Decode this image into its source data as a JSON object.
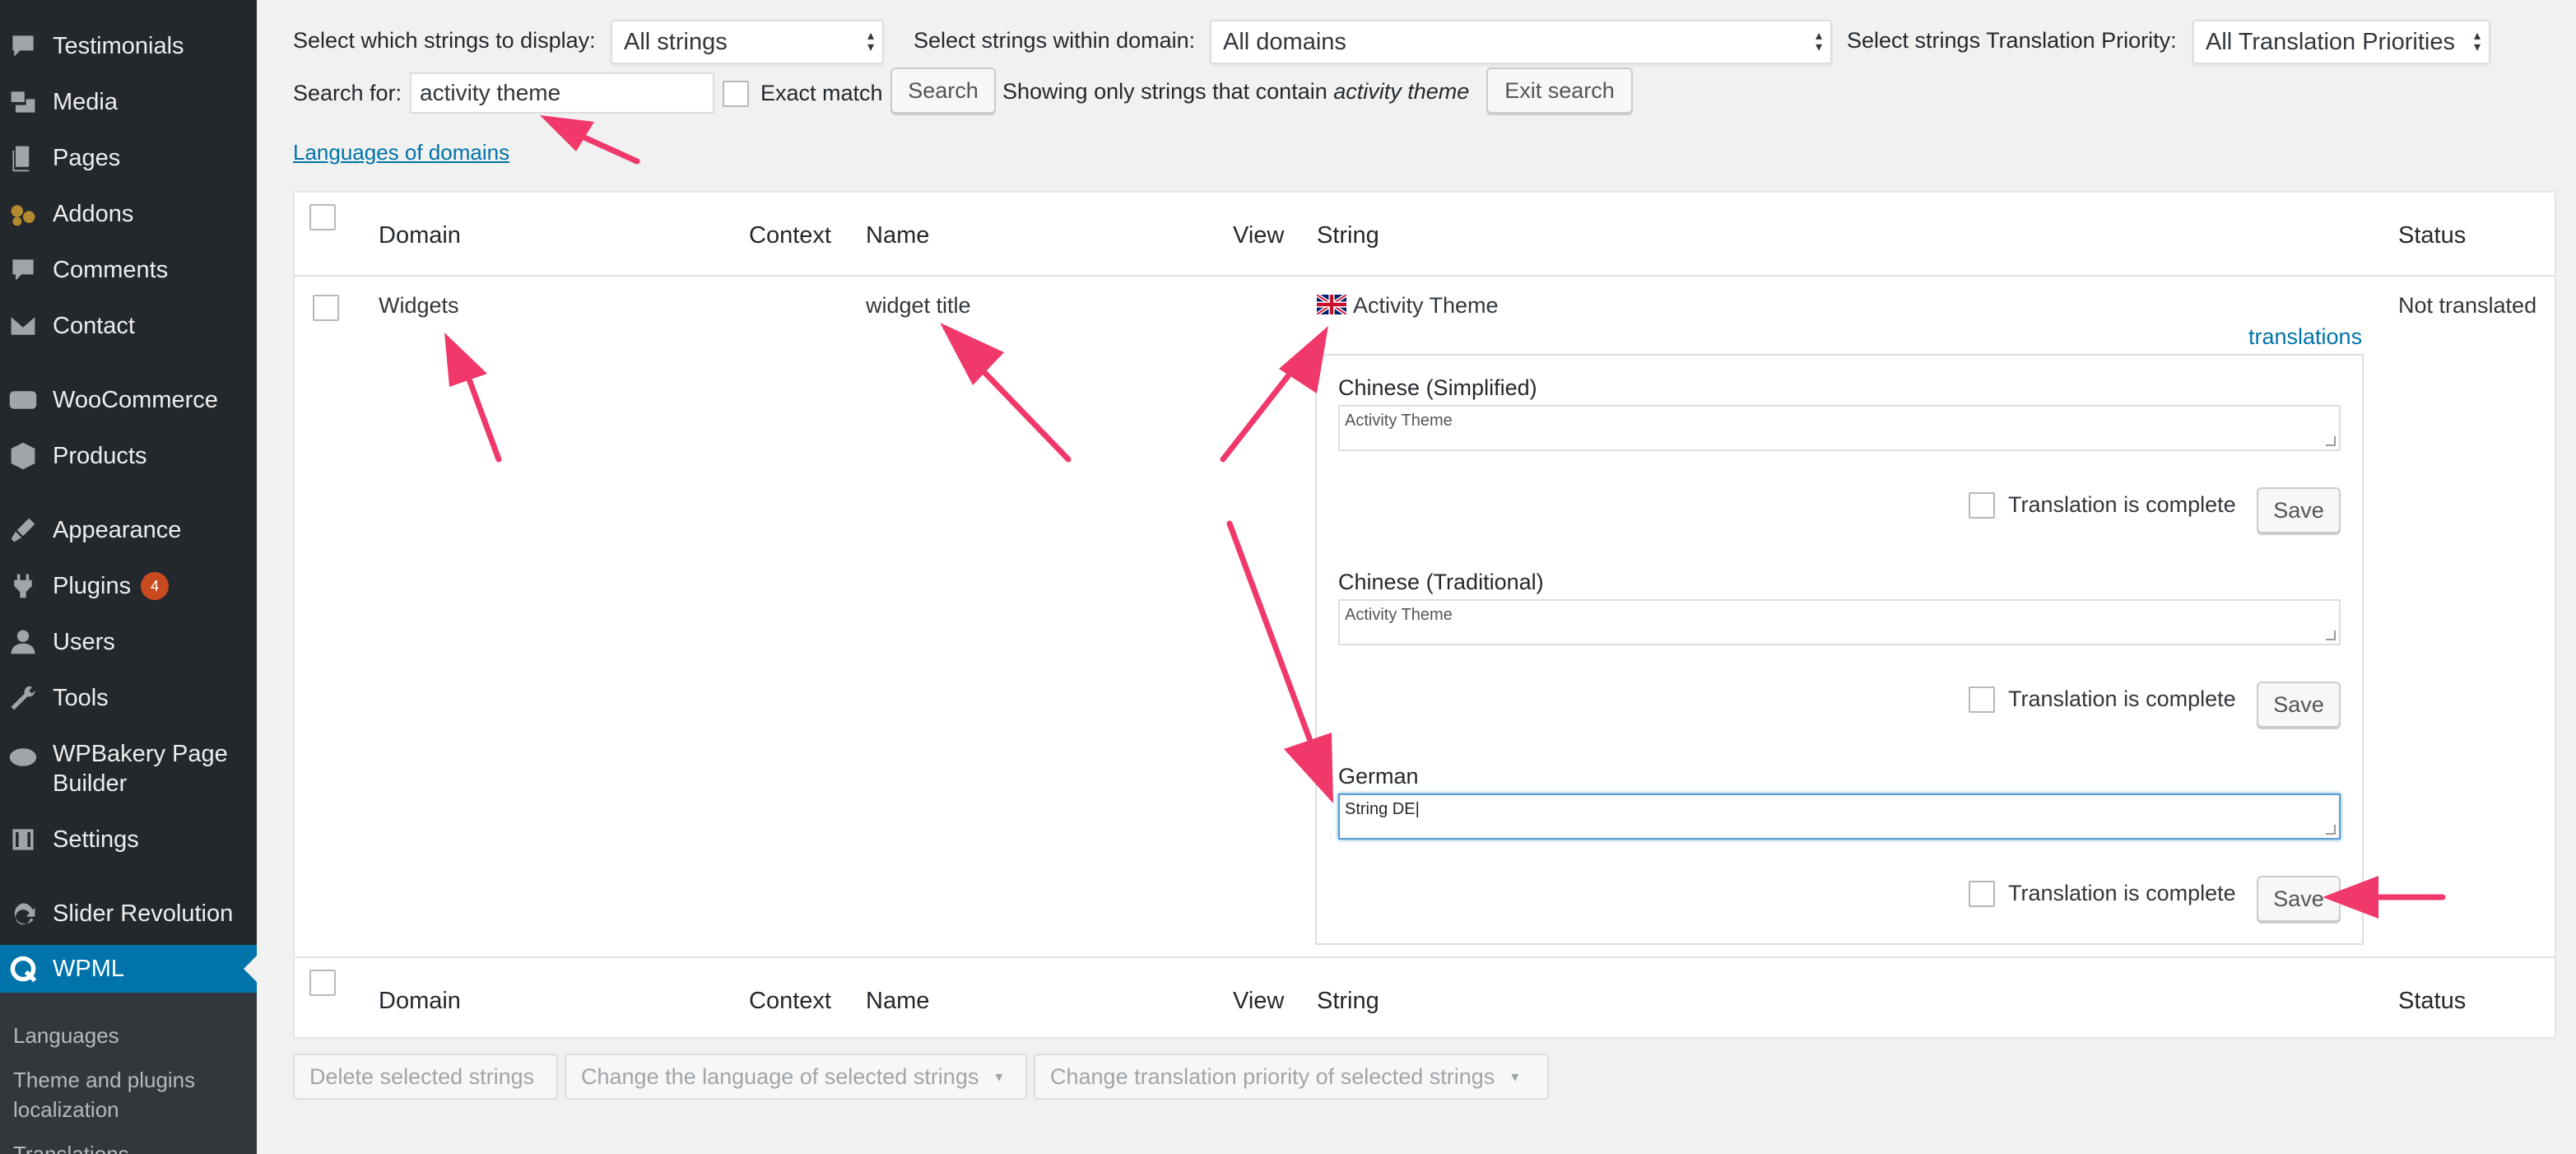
{
  "sidebar": {
    "items": [
      {
        "label": "Testimonials",
        "icon": "speech-bubble-icon"
      },
      {
        "label": "Media",
        "icon": "media-icon"
      },
      {
        "label": "Pages",
        "icon": "pages-icon"
      },
      {
        "label": "Addons",
        "icon": "addons-icon"
      },
      {
        "label": "Comments",
        "icon": "comments-icon"
      },
      {
        "label": "Contact",
        "icon": "envelope-icon"
      },
      {
        "label": "WooCommerce",
        "icon": "woo-icon"
      },
      {
        "label": "Products",
        "icon": "products-icon"
      },
      {
        "label": "Appearance",
        "icon": "paintbrush-icon"
      },
      {
        "label": "Plugins",
        "icon": "plugins-icon",
        "badge": "4"
      },
      {
        "label": "Users",
        "icon": "users-icon"
      },
      {
        "label": "Tools",
        "icon": "wrench-icon"
      },
      {
        "label": "WPBakery Page Builder",
        "icon": "wpbakery-icon"
      },
      {
        "label": "Settings",
        "icon": "settings-icon"
      },
      {
        "label": "Slider Revolution",
        "icon": "refresh-icon"
      },
      {
        "label": "WPML",
        "icon": "wpml-icon",
        "active": true
      }
    ],
    "submenu": [
      {
        "label": "Languages"
      },
      {
        "label": "Theme and plugins localization"
      },
      {
        "label": "Translations"
      }
    ]
  },
  "filters": {
    "display_label": "Select which strings to display:",
    "display_value": "All strings",
    "domain_label": "Select strings within domain:",
    "domain_value": "All domains",
    "priority_label": "Select strings Translation Priority:",
    "priority_value": "All Translation Priorities",
    "search_label": "Search for:",
    "search_value": "activity theme",
    "exact_match_label": "Exact match",
    "search_button": "Search",
    "showing_prefix": "Showing only strings that contain",
    "showing_term": "activity theme",
    "exit_search_button": "Exit search",
    "languages_of_domains_link": "Languages of domains"
  },
  "table": {
    "headers": {
      "domain": "Domain",
      "context": "Context",
      "name": "Name",
      "view": "View",
      "string": "String",
      "status": "Status"
    },
    "row": {
      "domain": "Widgets",
      "context": "",
      "name": "widget title",
      "string": "Activity Theme",
      "flag_icon": "uk-flag-icon",
      "translations_link": "translations",
      "status": "Not translated",
      "translations": [
        {
          "language": "Chinese (Simplified)",
          "value": "Activity Theme",
          "complete_label": "Translation is complete",
          "save_label": "Save"
        },
        {
          "language": "Chinese (Traditional)",
          "value": "Activity Theme",
          "complete_label": "Translation is complete",
          "save_label": "Save"
        },
        {
          "language": "German",
          "value": "String DE",
          "complete_label": "Translation is complete",
          "save_label": "Save"
        }
      ]
    }
  },
  "bulk_actions": {
    "delete": "Delete selected strings",
    "change_language": "Change the language of selected strings",
    "change_priority": "Change translation priority of selected strings"
  },
  "annotation_color": "#f0386b"
}
